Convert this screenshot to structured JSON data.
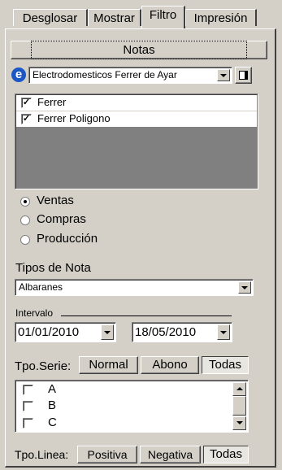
{
  "tabs": [
    {
      "label": "Desglosar"
    },
    {
      "label": "Mostrar"
    },
    {
      "label": "Filtro"
    },
    {
      "label": "Impresión"
    }
  ],
  "notas_button": "Notas",
  "company_combo": {
    "value": "Electrodomesticos Ferrer de Ayar"
  },
  "stores": [
    {
      "label": "Ferrer",
      "checked": true
    },
    {
      "label": "Ferrer Poligono",
      "checked": true
    }
  ],
  "type_options": [
    {
      "label": "Ventas",
      "selected": true
    },
    {
      "label": "Compras",
      "selected": false
    },
    {
      "label": "Producción",
      "selected": false
    }
  ],
  "tipos_nota": {
    "label": "Tipos de Nota",
    "value": "Albaranes"
  },
  "intervalo": {
    "label": "Intervalo",
    "from": "01/01/2010",
    "to": "18/05/2010"
  },
  "serie": {
    "label": "Tpo.Serie:",
    "buttons": [
      "Normal",
      "Abono",
      "Todas"
    ],
    "items": [
      {
        "label": "A",
        "checked": false
      },
      {
        "label": "B",
        "checked": false
      },
      {
        "label": "C",
        "checked": false
      }
    ]
  },
  "linea": {
    "label": "Tpo.Linea:",
    "buttons": [
      "Positiva",
      "Negativa",
      "Todas"
    ]
  },
  "colors": {
    "face": "#d4d0c8",
    "list_gray": "#808080",
    "ie_blue": "#1a56c4"
  }
}
